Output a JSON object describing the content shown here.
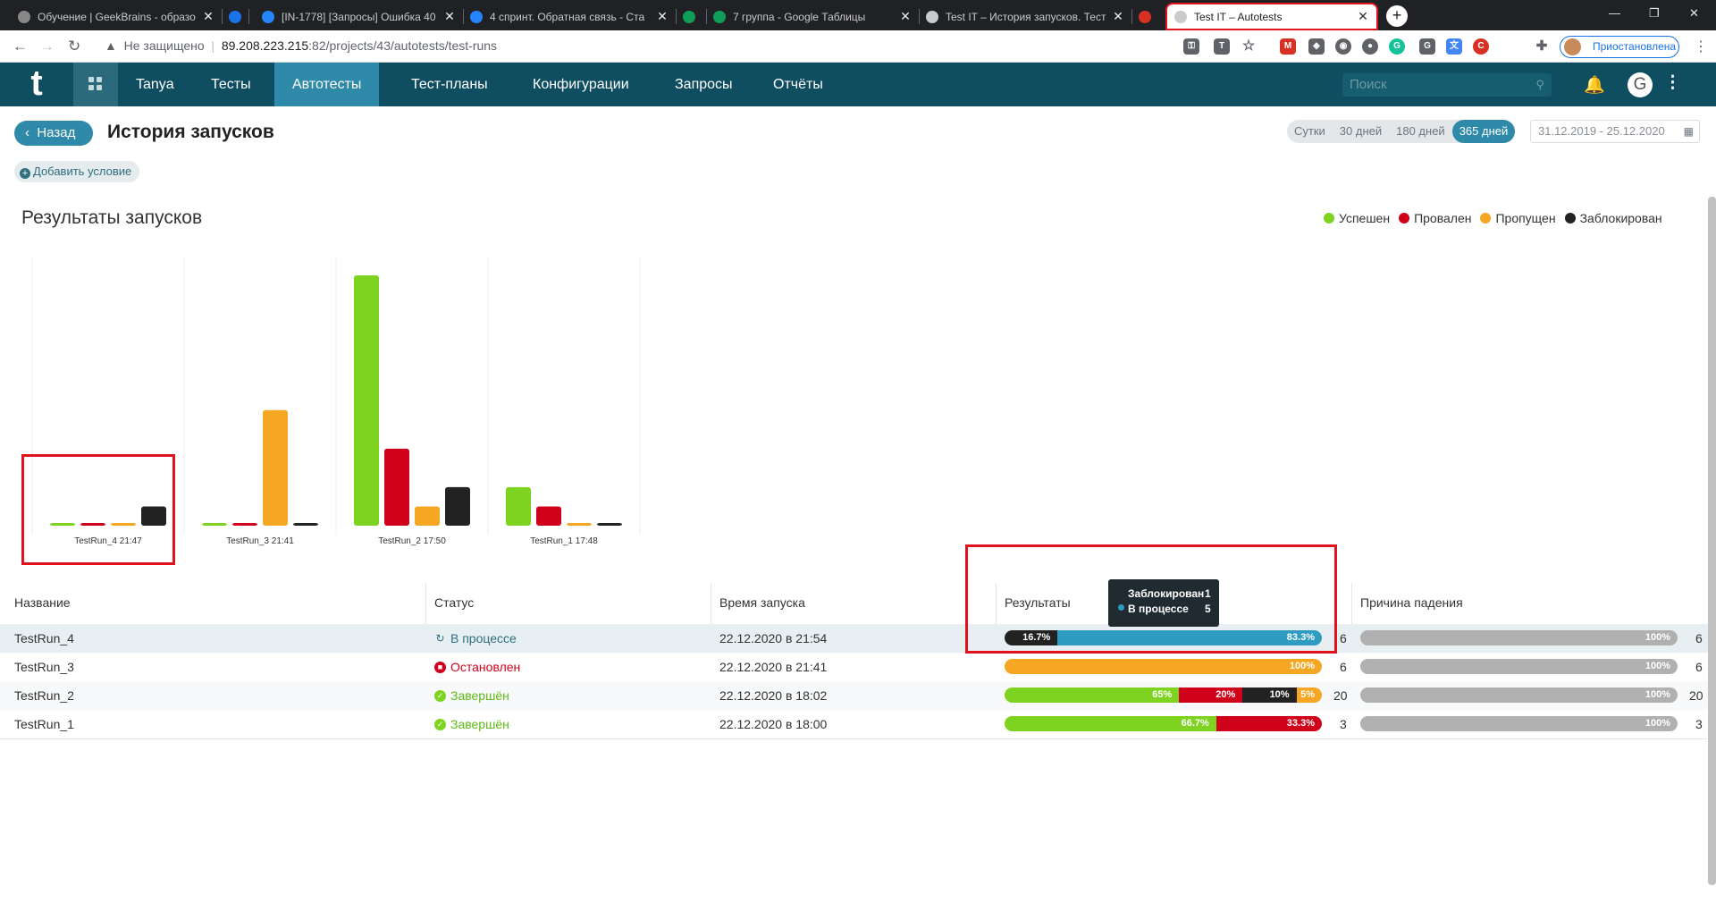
{
  "browser": {
    "tabs": [
      {
        "title": "Обучение | GeekBrains - образо",
        "icon": "geekbrains-icon",
        "active": false
      },
      {
        "title": "",
        "icon": "circle-icon",
        "active": false
      },
      {
        "title": "[IN-1778] [Запросы] Ошибка 40",
        "icon": "jira-icon",
        "active": false
      },
      {
        "title": "4 спринт. Обратная связь - Ста",
        "icon": "confluence-icon",
        "active": false
      },
      {
        "title": "",
        "icon": "green-circle-icon",
        "active": false
      },
      {
        "title": "7 группа - Google Таблицы",
        "icon": "sheets-icon",
        "active": false
      },
      {
        "title": "Test IT – История запусков. Тест",
        "icon": "testit-icon",
        "active": false
      },
      {
        "title": "",
        "icon": "red-circle-icon",
        "active": false
      },
      {
        "title": "Test IT – Autotests",
        "icon": "testit-icon",
        "active": true
      }
    ],
    "insecure_label": "Не защищено",
    "url_host": "89.208.223.215",
    "url_rest": ":82/projects/43/autotests/test-runs",
    "profile_label": "Приостановлена"
  },
  "nav": {
    "logo": "t",
    "items": [
      "Tanya",
      "Тесты",
      "Автотесты",
      "Тест-планы",
      "Конфигурации",
      "Запросы",
      "Отчёты"
    ],
    "active": "Автотесты",
    "search_placeholder": "Поиск",
    "avatar_letter": "G"
  },
  "header": {
    "back_label": "Назад",
    "title": "История запусков",
    "periods": [
      "Сутки",
      "30 дней",
      "180 дней",
      "365 дней"
    ],
    "active_period": "365 дней",
    "date_range": "31.12.2019 - 25.12.2020",
    "add_condition": "Добавить условие"
  },
  "results_title": "Результаты запусков",
  "colors": {
    "success": "#7ed321",
    "failed": "#d0021b",
    "skipped": "#f5a623",
    "blocked": "#222222",
    "in_progress": "#2e9bc0",
    "cause": "#b0b0b0"
  },
  "chart_data": {
    "type": "bar",
    "title": "Результаты запусков",
    "categories": [
      "TestRun_4 21:47",
      "TestRun_3 21:41",
      "TestRun_2 17:50",
      "TestRun_1 17:48"
    ],
    "series": [
      {
        "name": "Успешен",
        "values": [
          0,
          0,
          13,
          2
        ]
      },
      {
        "name": "Провален",
        "values": [
          0,
          0,
          4,
          1
        ]
      },
      {
        "name": "Пропущен",
        "values": [
          0,
          6,
          1,
          0
        ]
      },
      {
        "name": "Заблокирован",
        "values": [
          1,
          0,
          2,
          0
        ]
      }
    ],
    "legend_position": "top-right",
    "grid": false
  },
  "table": {
    "headers": [
      "Название",
      "Статус",
      "Время запуска",
      "Результаты",
      "Причина падения"
    ],
    "rows": [
      {
        "name": "TestRun_4",
        "status": "В процессе",
        "status_kind": "progress",
        "time": "22.12.2020 в 21:54",
        "results": [
          {
            "label": "16.7%",
            "pct": 16.7,
            "kind": "blocked"
          },
          {
            "label": "83.3%",
            "pct": 83.3,
            "kind": "in_progress"
          }
        ],
        "count": "6",
        "cause_label": "100%",
        "cause_count": "6"
      },
      {
        "name": "TestRun_3",
        "status": "Остановлен",
        "status_kind": "stopped",
        "time": "22.12.2020 в 21:41",
        "results": [
          {
            "label": "100%",
            "pct": 100,
            "kind": "skipped"
          }
        ],
        "count": "6",
        "cause_label": "100%",
        "cause_count": "6"
      },
      {
        "name": "TestRun_2",
        "status": "Завершён",
        "status_kind": "done",
        "time": "22.12.2020 в 18:02",
        "results": [
          {
            "label": "65%",
            "pct": 55,
            "kind": "success"
          },
          {
            "label": "20%",
            "pct": 20,
            "kind": "failed"
          },
          {
            "label": "10%",
            "pct": 17,
            "kind": "blocked"
          },
          {
            "label": "5%",
            "pct": 8,
            "kind": "skipped"
          }
        ],
        "count": "20",
        "cause_label": "100%",
        "cause_count": "20"
      },
      {
        "name": "TestRun_1",
        "status": "Завершён",
        "status_kind": "done",
        "time": "22.12.2020 в 18:00",
        "results": [
          {
            "label": "66.7%",
            "pct": 66.7,
            "kind": "success"
          },
          {
            "label": "33.3%",
            "pct": 33.3,
            "kind": "failed"
          }
        ],
        "count": "3",
        "cause_label": "100%",
        "cause_count": "3"
      }
    ]
  },
  "tooltip": {
    "line1": "Заблокирован",
    "val1": "1",
    "line2": "В процессе",
    "val2": "5"
  }
}
